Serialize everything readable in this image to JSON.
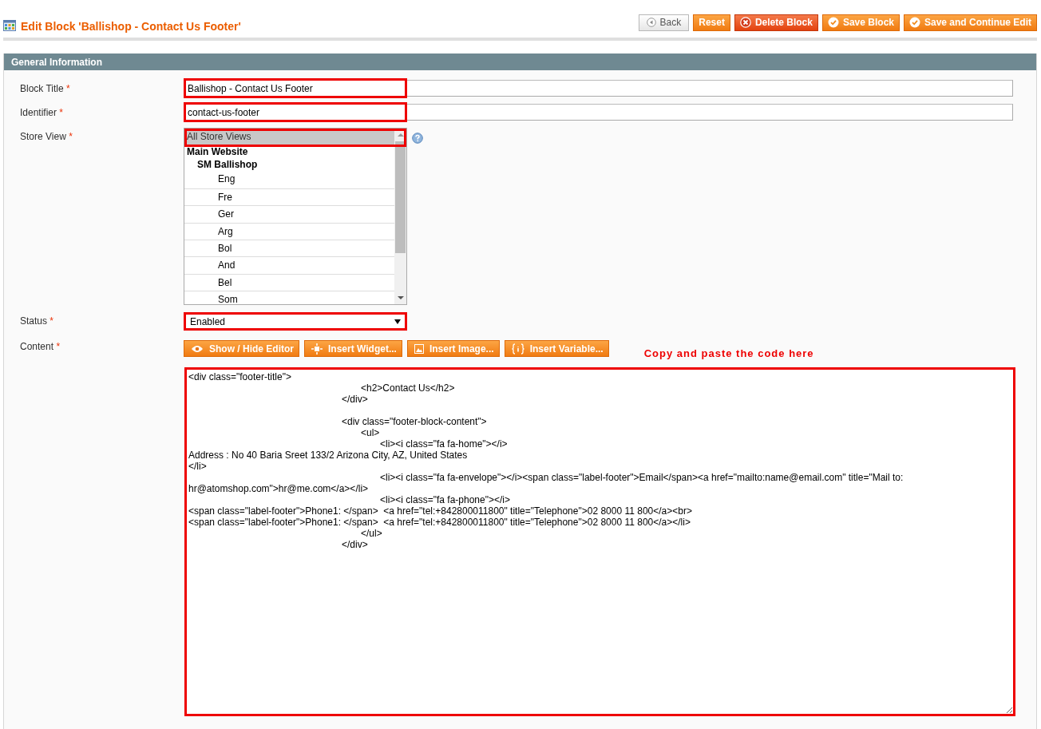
{
  "page_title": "Edit Block 'Ballishop - Contact Us Footer'",
  "buttons": [
    {
      "label": "Back",
      "kind": "back"
    },
    {
      "label": "Reset",
      "kind": "plain"
    },
    {
      "label": "Delete Block",
      "kind": "delete"
    },
    {
      "label": "Save Block",
      "kind": "save"
    },
    {
      "label": "Save and Continue Edit",
      "kind": "save"
    }
  ],
  "section": {
    "title": "General Information"
  },
  "fields": [
    {
      "label": "Block Title",
      "required": "*",
      "kind": "text",
      "value": "Ballishop - Contact Us Footer",
      "highlighted": true
    },
    {
      "label": "Identifier",
      "required": "*",
      "kind": "text",
      "value": "contact-us-footer",
      "highlighted": true
    },
    {
      "label": "Store View",
      "required": "*",
      "kind": "multiselect",
      "highlighted": true,
      "options": [
        {
          "label": "All Store Views",
          "selected": true
        },
        {
          "label": "Main Website",
          "children": [
            {
              "label": "SM Ballishop",
              "children": [
                {
                  "label": "Eng",
                  "selected": false
                },
                {
                  "label": "Fre",
                  "selected": false
                },
                {
                  "label": "Ger",
                  "selected": false
                },
                {
                  "label": "Arg",
                  "selected": false
                },
                {
                  "label": "Bol",
                  "selected": false
                },
                {
                  "label": "And",
                  "selected": false
                },
                {
                  "label": "Bel",
                  "selected": false
                },
                {
                  "label": "Som",
                  "selected": false
                }
              ]
            }
          ]
        }
      ]
    },
    {
      "label": "Status",
      "required": "*",
      "kind": "select",
      "value": "Enabled",
      "highlighted": true
    },
    {
      "label": "Content",
      "required": "*",
      "kind": "editor",
      "highlighted": true,
      "toolbar": [
        {
          "label": "Show / Hide Editor",
          "kind": "eye"
        },
        {
          "label": "Insert Widget...",
          "kind": "widget"
        },
        {
          "label": "Insert Image...",
          "kind": "image"
        },
        {
          "label": "Insert Variable...",
          "kind": "variable"
        }
      ],
      "annotation": "Copy and paste the code here",
      "value": "<div class=\"footer-title\">\n\t\t\t\t\t\t\t\t\t<h2>Contact Us</h2>\n\t\t\t\t\t\t\t\t</div>\n\n\t\t\t\t\t\t\t\t<div class=\"footer-block-content\">\n\t\t\t\t\t\t\t\t\t<ul>\n\t\t\t\t\t\t\t\t\t\t<li><i class=\"fa fa-home\"></i>\nAddress : No 40 Baria Sreet 133/2 Arizona City, AZ, United States\n</li>\n\t\t\t\t\t\t\t\t\t\t<li><i class=\"fa fa-envelope\"></i><span class=\"label-footer\">Email</span><a href=\"mailto:name@email.com\" title=\"Mail to: hr@atomshop.com\">hr@me.com</a></li>\n\t\t\t\t\t\t\t\t\t\t<li><i class=\"fa fa-phone\"></i>\n<span class=\"label-footer\">Phone1: </span>  <a href=\"tel:+842800011800\" title=\"Telephone\">02 8000 11 800</a><br>\n<span class=\"label-footer\">Phone1: </span>  <a href=\"tel:+842800011800\" title=\"Telephone\">02 8000 11 800</a></li>\n\t\t\t\t\t\t\t\t\t</ul>\n\t\t\t\t\t\t\t\t</div>"
    }
  ]
}
